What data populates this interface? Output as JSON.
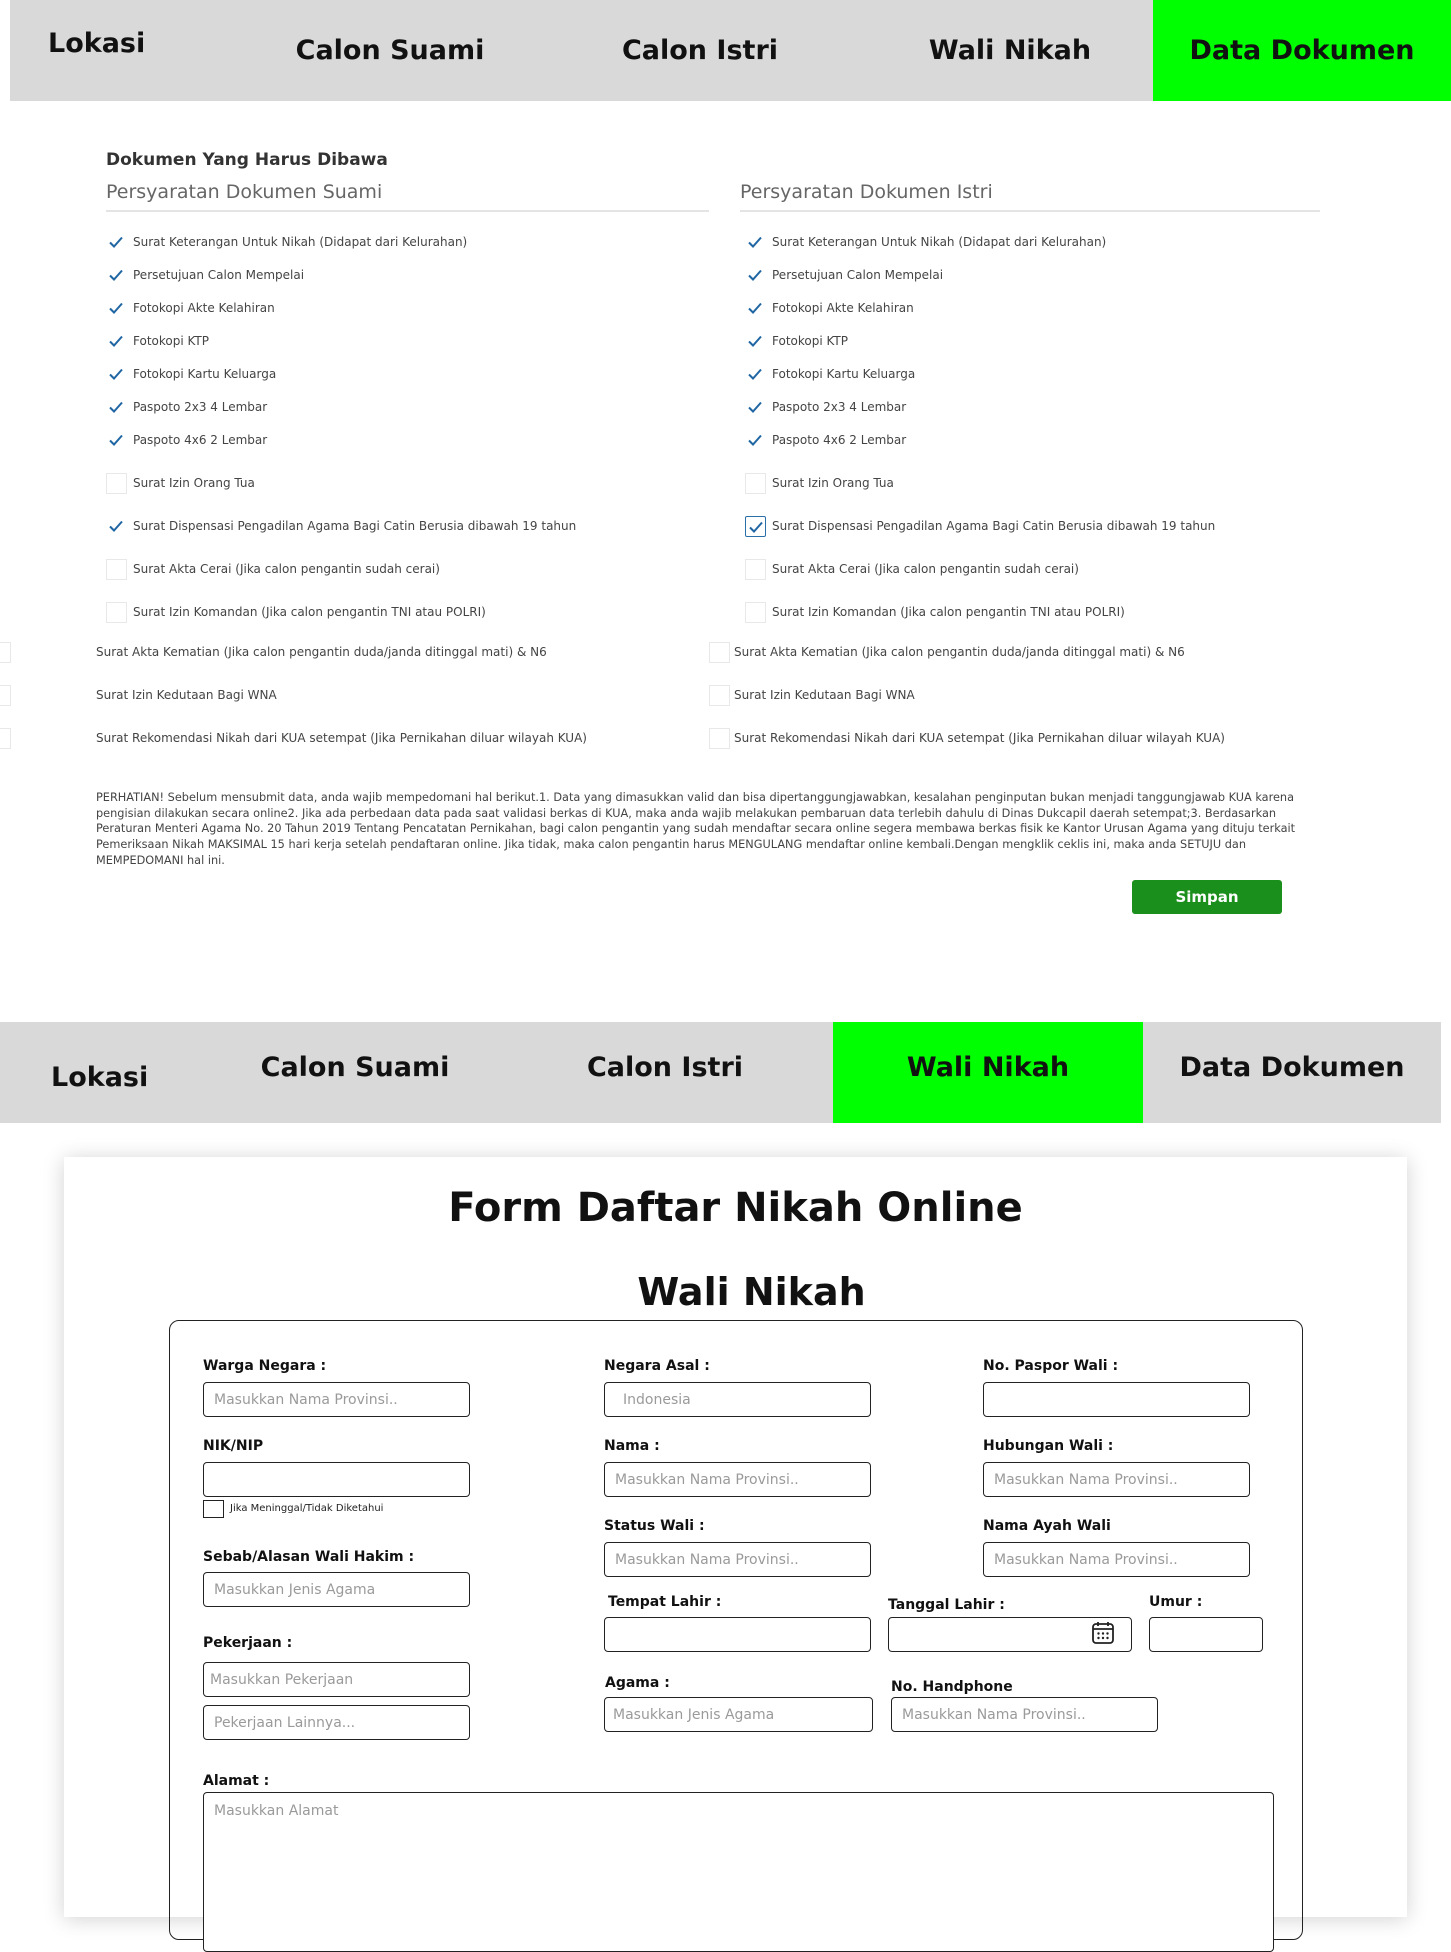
{
  "nav_top": {
    "tabs": [
      {
        "label": "Lokasi",
        "active": false
      },
      {
        "label": "Calon Suami",
        "active": false
      },
      {
        "label": "Calon Istri",
        "active": false
      },
      {
        "label": "Wali Nikah",
        "active": false
      },
      {
        "label": "Data Dokumen",
        "active": true
      }
    ]
  },
  "documents": {
    "heading": "Dokumen Yang Harus Dibawa",
    "suami": {
      "title": "Persyaratan Dokumen Suami",
      "items": [
        {
          "label": "Surat Keterangan Untuk Nikah (Didapat dari Kelurahan)",
          "checked": true
        },
        {
          "label": "Persetujuan Calon Mempelai",
          "checked": true
        },
        {
          "label": "Fotokopi Akte Kelahiran",
          "checked": true
        },
        {
          "label": "Fotokopi KTP",
          "checked": true
        },
        {
          "label": "Fotokopi Kartu Keluarga",
          "checked": true
        },
        {
          "label": "Paspoto 2x3 4 Lembar",
          "checked": true
        },
        {
          "label": "Paspoto 4x6 2 Lembar",
          "checked": true
        },
        {
          "label": "Surat Izin Orang Tua",
          "checked": false
        },
        {
          "label": "Surat Dispensasi Pengadilan Agama Bagi Catin Berusia dibawah 19 tahun",
          "checked": true
        },
        {
          "label": "Surat Akta Cerai (Jika calon pengantin sudah cerai)",
          "checked": false
        },
        {
          "label": "Surat Izin Komandan (Jika calon pengantin TNI atau POLRI)",
          "checked": false
        },
        {
          "label": "Surat Akta Kematian (Jika calon pengantin duda/janda ditinggal mati) & N6",
          "checked": false
        },
        {
          "label": "Surat Izin Kedutaan Bagi WNA",
          "checked": false
        },
        {
          "label": "Surat Rekomendasi Nikah dari KUA setempat (Jika Pernikahan diluar wilayah KUA)",
          "checked": false
        }
      ]
    },
    "istri": {
      "title": "Persyaratan Dokumen Istri",
      "items": [
        {
          "label": "Surat Keterangan Untuk Nikah (Didapat dari Kelurahan)",
          "checked": true
        },
        {
          "label": "Persetujuan Calon Mempelai",
          "checked": true
        },
        {
          "label": "Fotokopi Akte Kelahiran",
          "checked": true
        },
        {
          "label": "Fotokopi KTP",
          "checked": true
        },
        {
          "label": "Fotokopi Kartu Keluarga",
          "checked": true
        },
        {
          "label": "Paspoto 2x3 4 Lembar",
          "checked": true
        },
        {
          "label": "Paspoto 4x6 2 Lembar",
          "checked": true
        },
        {
          "label": "Surat Izin Orang Tua",
          "checked": false
        },
        {
          "label": "Surat Dispensasi Pengadilan Agama Bagi Catin Berusia dibawah 19 tahun",
          "checked": true
        },
        {
          "label": "Surat Akta Cerai (Jika calon pengantin sudah cerai)",
          "checked": false
        },
        {
          "label": "Surat Izin Komandan (Jika calon pengantin TNI atau POLRI)",
          "checked": false
        },
        {
          "label": "Surat Akta Kematian (Jika calon pengantin duda/janda ditinggal mati) & N6",
          "checked": false
        },
        {
          "label": "Surat Izin Kedutaan Bagi WNA",
          "checked": false
        },
        {
          "label": "Surat Rekomendasi Nikah dari KUA setempat (Jika Pernikahan diluar wilayah KUA)",
          "checked": false
        }
      ]
    },
    "warning": "PERHATIAN! Sebelum mensubmit data, anda wajib mempedomani hal berikut.1. Data yang dimasukkan valid dan bisa dipertanggungjawabkan, kesalahan penginputan bukan menjadi tanggungjawab KUA karena pengisian dilakukan secara online2. Jika ada perbedaan data pada saat validasi berkas di KUA, maka anda wajib melakukan pembaruan data terlebih dahulu di Dinas Dukcapil daerah setempat;3. Berdasarkan Peraturan Menteri Agama No. 20 Tahun 2019 Tentang Pencatatan Pernikahan, bagi calon pengantin yang sudah mendaftar secara online segera membawa berkas fisik ke Kantor Urusan Agama yang dituju terkait Pemeriksaan Nikah MAKSIMAL 15 hari kerja setelah pendaftaran online. Jika tidak, maka calon pengantin harus MENGULANG mendaftar online kembali.Dengan mengklik ceklis ini, maka anda SETUJU dan MEMPEDOMANI hal ini.",
    "save_label": "Simpan"
  },
  "nav_bottom": {
    "tabs": [
      {
        "label": "Lokasi",
        "active": false
      },
      {
        "label": "Calon Suami",
        "active": false
      },
      {
        "label": "Calon Istri",
        "active": false
      },
      {
        "label": "Wali Nikah",
        "active": true
      },
      {
        "label": "Data Dokumen",
        "active": false
      }
    ]
  },
  "form": {
    "title": "Form Daftar Nikah Online",
    "subtitle": "Wali Nikah",
    "fields": {
      "warga_negara": {
        "label": "Warga Negara :",
        "placeholder": "Masukkan Nama Provinsi.."
      },
      "negara_asal": {
        "label": "Negara Asal :",
        "value": "Indonesia"
      },
      "no_paspor": {
        "label": "No. Paspor Wali :",
        "placeholder": ""
      },
      "nik": {
        "label": "NIK/NIP",
        "placeholder": ""
      },
      "nama": {
        "label": "Nama :",
        "placeholder": "Masukkan Nama Provinsi.."
      },
      "hubungan": {
        "label": "Hubungan Wali :",
        "placeholder": "Masukkan Nama Provinsi.."
      },
      "meninggal_label": "Jika Meninggal/Tidak Diketahui",
      "status_wali": {
        "label": "Status Wali :",
        "placeholder": "Masukkan Nama Provinsi.."
      },
      "nama_ayah": {
        "label": "Nama Ayah Wali",
        "placeholder": "Masukkan Nama Provinsi.."
      },
      "sebab": {
        "label": "Sebab/Alasan Wali Hakim :",
        "placeholder": "Masukkan Jenis Agama"
      },
      "tempat_lahir": {
        "label": "Tempat Lahir :",
        "placeholder": ""
      },
      "tanggal_lahir": {
        "label": "Tanggal Lahir :",
        "placeholder": ""
      },
      "umur": {
        "label": "Umur :",
        "placeholder": ""
      },
      "pekerjaan": {
        "label": "Pekerjaan :",
        "placeholder": "Masukkan Pekerjaan",
        "placeholder_other": "Pekerjaan Lainnya..."
      },
      "agama": {
        "label": "Agama :",
        "placeholder": "Masukkan Jenis Agama"
      },
      "handphone": {
        "label": "No. Handphone",
        "placeholder": "Masukkan Nama Provinsi.."
      },
      "alamat": {
        "label": "Alamat :",
        "placeholder": "Masukkan Alamat"
      }
    }
  },
  "colors": {
    "active_tab": "#00ff00",
    "nav_bg": "#d9d9d9",
    "check": "#1f66a3",
    "save_button": "#1b8f1b"
  },
  "icons": {
    "check": "check-icon",
    "calendar": "calendar-icon"
  }
}
